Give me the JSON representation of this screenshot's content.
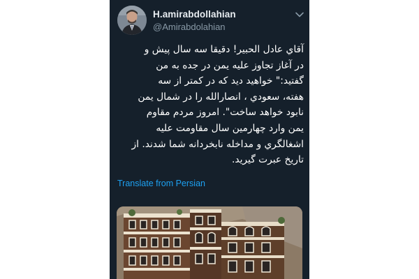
{
  "tweet": {
    "display_name": "H.amirabdollahian",
    "handle": "@Amirabdolahian",
    "text": "آقاي عادل الحبير! دقيقا سه سال پيش و\nدر آغاز تجاوز  عليه يمن  در جده به من\nگفتيد:\" خواهيد ديد كه در كمتر  از سه\nهفته، سعودي ، انصارالله را در شمال يمن\nنابود خواهد ساخت\".  امروز مردم مقاوم\nيمن وارد چهارمين سال مقاومت عليه\nاشغالگري و مداخله نابخردانه شما شدند. از\nتاريخ عبرت گيريد.",
    "translate_label": "Translate from Persian"
  },
  "colors": {
    "background": "#15202b",
    "text": "#ffffff",
    "secondary_text": "#8899a6",
    "link": "#1da1f2"
  },
  "icons": {
    "avatar": "profile-photo",
    "menu": "chevron-down-icon",
    "media": "tweet-photo"
  }
}
